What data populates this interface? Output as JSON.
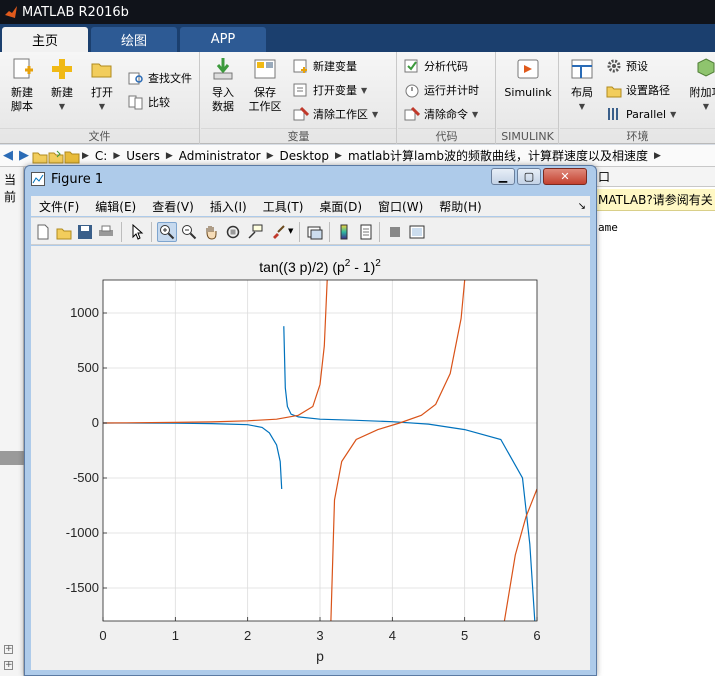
{
  "matlab": {
    "title": "MATLAB R2016b",
    "tabs": [
      "主页",
      "绘图",
      "APP"
    ],
    "ribbon": {
      "file": {
        "label": "文件",
        "new_script": "新建\n脚本",
        "new": "新建",
        "open": "打开",
        "find_files": "查找文件",
        "compare": "比较"
      },
      "variable": {
        "label": "变量",
        "import_data": "导入\n数据",
        "save_workspace": "保存\n工作区",
        "new_variable": "新建变量",
        "open_variable": "打开变量",
        "clear_workspace": "清除工作区"
      },
      "code": {
        "label": "代码",
        "analyze_code": "分析代码",
        "run_and_time": "运行并计时",
        "clear_commands": "清除命令"
      },
      "simulink": {
        "label": "SIMULINK",
        "button": "Simulink"
      },
      "environment": {
        "label": "环境",
        "layout": "布局",
        "preferences": "预设",
        "set_path": "设置路径",
        "parallel": "Parallel",
        "addons": "附加功"
      }
    },
    "address": {
      "crumbs": [
        "C:",
        "Users",
        "Administrator",
        "Desktop",
        "matlab计算lamb波的频散曲线，计算群速度以及相速度"
      ]
    },
    "left_pane_label": "当前",
    "right_pane": {
      "strip_label": "口",
      "notice": "MATLAB?请参阅有关",
      "code_text": "ame"
    }
  },
  "figure": {
    "title": "Figure 1",
    "menu": [
      "文件(F)",
      "编辑(E)",
      "查看(V)",
      "插入(I)",
      "工具(T)",
      "桌面(D)",
      "窗口(W)",
      "帮助(H)"
    ],
    "toolbar_icons": [
      "new-figure-icon",
      "open-file-icon",
      "save-icon",
      "print-icon",
      "pointer-icon",
      "zoom-in-icon",
      "zoom-out-icon",
      "pan-icon",
      "rotate-icon",
      "data-cursor-icon",
      "brush-icon",
      "link-plot-icon",
      "colorbar-icon",
      "legend-icon",
      "hide-plot-tools-icon",
      "show-plot-tools-icon"
    ]
  },
  "chart_data": {
    "type": "line",
    "title_base": "tan((3 p)/2) (p",
    "title_mid": " - 1)",
    "title_exp": "2",
    "xlabel": "p",
    "ylabel": "",
    "xlim": [
      0,
      6
    ],
    "ylim": [
      -1800,
      1300
    ],
    "xticks": [
      "0",
      "1",
      "2",
      "3",
      "4",
      "5",
      "6"
    ],
    "yticks": [
      "-1500",
      "-1000",
      "-500",
      "0",
      "500",
      "1000"
    ],
    "grid": true,
    "series": [
      {
        "color": "#0072bd",
        "segments": [
          [
            [
              0,
              0
            ],
            [
              1,
              -2
            ],
            [
              1.5,
              -5
            ],
            [
              2,
              -15
            ],
            [
              2.2,
              -40
            ],
            [
              2.3,
              -90
            ],
            [
              2.4,
              -200
            ],
            [
              2.45,
              -350
            ],
            [
              2.47,
              -600
            ]
          ],
          [
            [
              2.5,
              880
            ],
            [
              2.52,
              320
            ],
            [
              2.55,
              150
            ],
            [
              2.6,
              80
            ],
            [
              2.7,
              55
            ],
            [
              3,
              35
            ],
            [
              3.5,
              25
            ],
            [
              4,
              12
            ],
            [
              4.5,
              -10
            ],
            [
              5,
              -60
            ],
            [
              5.5,
              -150
            ],
            [
              5.8,
              -500
            ],
            [
              5.9,
              -1100
            ],
            [
              5.97,
              -1800
            ]
          ]
        ]
      },
      {
        "color": "#d95319",
        "segments": [
          [
            [
              0,
              0
            ],
            [
              1,
              5
            ],
            [
              1.5,
              10
            ],
            [
              2,
              20
            ],
            [
              2.4,
              35
            ],
            [
              2.7,
              70
            ],
            [
              2.9,
              150
            ],
            [
              3.0,
              350
            ],
            [
              3.06,
              700
            ],
            [
              3.1,
              1300
            ]
          ],
          [
            [
              3.15,
              -1800
            ],
            [
              3.2,
              -700
            ],
            [
              3.3,
              -350
            ],
            [
              3.5,
              -150
            ],
            [
              3.8,
              -60
            ],
            [
              4.1,
              0
            ],
            [
              4.4,
              70
            ],
            [
              4.6,
              170
            ],
            [
              4.8,
              450
            ],
            [
              4.95,
              950
            ],
            [
              5.0,
              1300
            ]
          ],
          [
            [
              5.55,
              -1800
            ],
            [
              5.7,
              -1200
            ],
            [
              5.85,
              -850
            ],
            [
              6.0,
              -600
            ]
          ]
        ]
      }
    ]
  }
}
